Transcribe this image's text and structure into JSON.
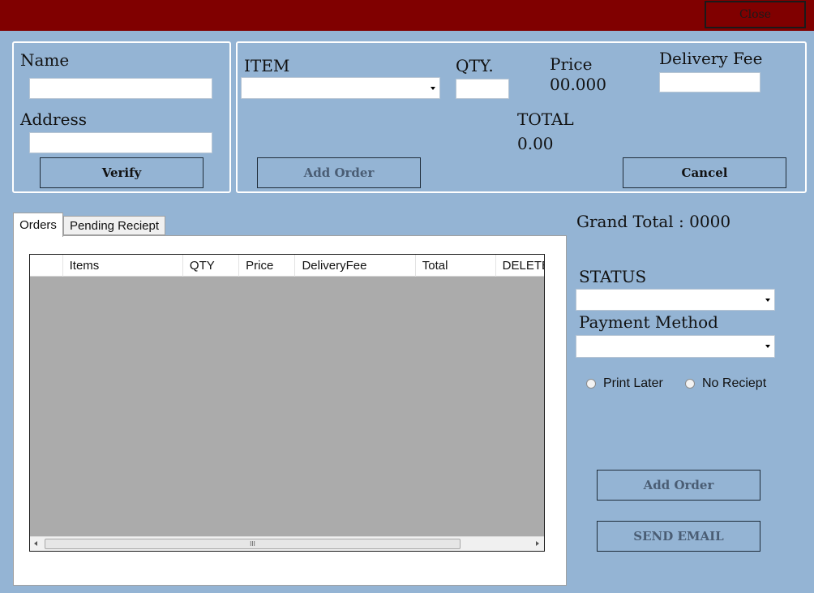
{
  "window": {
    "close_label": "Close",
    "accent": "#800000",
    "background": "#94b4d4"
  },
  "customer": {
    "name_label": "Name",
    "name_value": "",
    "address_label": "Address",
    "address_value": "",
    "verify_label": "Verify"
  },
  "order": {
    "item_label": "ITEM",
    "item_value": "",
    "qty_label": "QTY.",
    "qty_value": "",
    "price_label": "Price",
    "price_value": "00.000",
    "delivery_label": "Delivery Fee",
    "delivery_value": "",
    "total_label": "TOTAL",
    "total_value": "0.00",
    "add_order_label": "Add Order",
    "cancel_label": "Cancel"
  },
  "tabs": [
    {
      "label": "Orders",
      "active": true
    },
    {
      "label": "Pending Reciept",
      "active": false
    }
  ],
  "grid": {
    "columns": [
      "",
      "Items",
      "QTY",
      "Price",
      "DeliveryFee",
      "Total",
      "DELETE"
    ],
    "rows": [],
    "scroll_thumb_glyph": "III"
  },
  "summary": {
    "grand_total_label": "Grand Total : 0000",
    "status_label": "STATUS",
    "status_value": "",
    "payment_label": "Payment Method",
    "payment_value": "",
    "radio_print_later": "Print Later",
    "radio_no_receipt": "No Reciept",
    "add_order_label": "Add Order",
    "send_email_label": "SEND EMAIL"
  }
}
